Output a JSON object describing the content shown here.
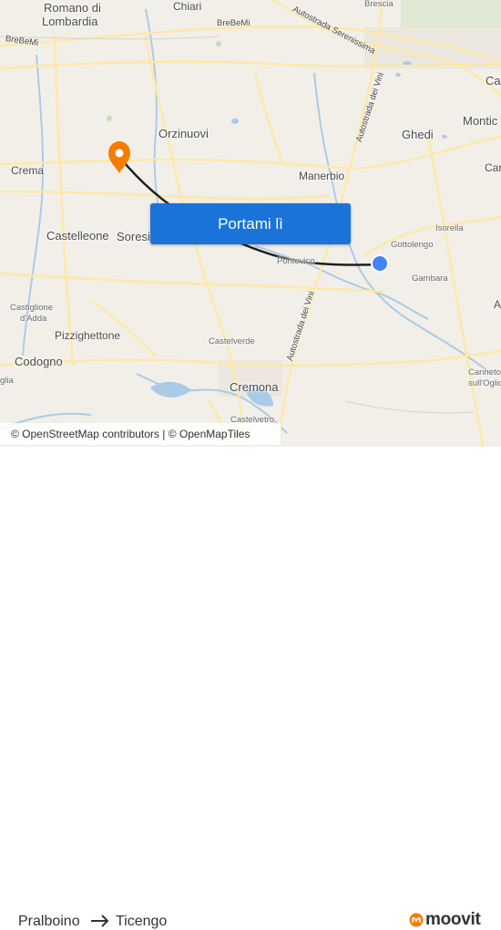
{
  "map": {
    "places": [
      {
        "id": "romano",
        "label": "Romano di"
      },
      {
        "id": "lombardia",
        "label": "Lombardia"
      },
      {
        "id": "chiari",
        "label": "Chiari"
      },
      {
        "id": "brescia",
        "label": "Brescia"
      },
      {
        "id": "cal",
        "label": "Cal"
      },
      {
        "id": "montic",
        "label": "Montic"
      },
      {
        "id": "orzinuovi",
        "label": "Orzinuovi"
      },
      {
        "id": "ghedi",
        "label": "Ghedi"
      },
      {
        "id": "car",
        "label": "Car"
      },
      {
        "id": "crema",
        "label": "Crema"
      },
      {
        "id": "manerbio",
        "label": "Manerbio"
      },
      {
        "id": "isorella",
        "label": "Isorella"
      },
      {
        "id": "castelleone",
        "label": "Castelleone"
      },
      {
        "id": "soresina",
        "label": "Soresina"
      },
      {
        "id": "gottolengo",
        "label": "Gottolengo"
      },
      {
        "id": "pontevico",
        "label": "Pontevico"
      },
      {
        "id": "gambara",
        "label": "Gambara"
      },
      {
        "id": "castiglione",
        "label": "Castiglione"
      },
      {
        "id": "dadda",
        "label": "d'Adda"
      },
      {
        "id": "pizzighettone",
        "label": "Pizzighettone"
      },
      {
        "id": "castelverde",
        "label": "Castelverde"
      },
      {
        "id": "codogno",
        "label": "Codogno"
      },
      {
        "id": "glia",
        "label": "glia"
      },
      {
        "id": "cremona",
        "label": "Cremona"
      },
      {
        "id": "canneto",
        "label": "Canneto"
      },
      {
        "id": "sulloglio",
        "label": "sull'Oglio"
      },
      {
        "id": "castelvetro",
        "label": "Castelvetro"
      },
      {
        "id": "a",
        "label": "A"
      }
    ],
    "roads": {
      "brebemi_west": "BreBeMi",
      "brebemi_east": "BreBeMi",
      "serenissima": "Autostrada Serenissima",
      "vini_north": "Autostrada dei Vini",
      "vini_south": "Autostrada dei Vini"
    },
    "colors": {
      "land": "#f2efe9",
      "road": "#fde9a6",
      "water": "#aacbe6",
      "route": "#1e1e1e",
      "origin_pin": "#4285f4",
      "dest_pin": "#f57c00"
    }
  },
  "cta": {
    "label": "Portami lì"
  },
  "attribution": "© OpenStreetMap contributors | © OpenMapTiles",
  "footer": {
    "origin": "Pralboino",
    "destination": "Ticengo",
    "brand": "moovit"
  }
}
